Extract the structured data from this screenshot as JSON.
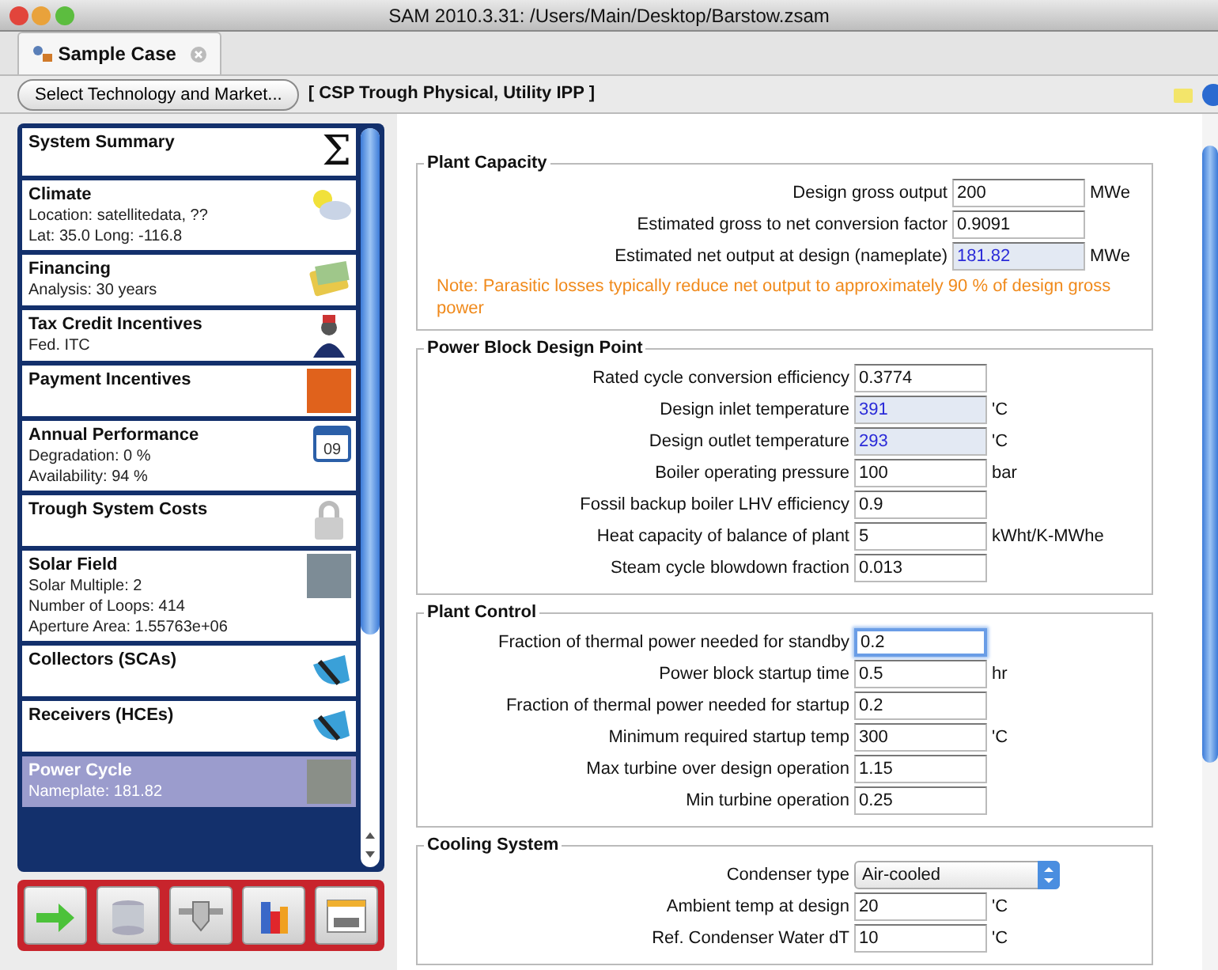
{
  "window": {
    "title": "SAM 2010.3.31: /Users/Main/Desktop/Barstow.zsam"
  },
  "tabs": [
    {
      "label": "Sample Case",
      "selected": true
    }
  ],
  "toolbar": {
    "button": "Select Technology and Market...",
    "technology": "[ CSP Trough Physical, Utility IPP ]"
  },
  "sidebar": {
    "items": [
      {
        "title": "System Summary",
        "symbol": "Σ",
        "selected": false
      },
      {
        "title": "Climate",
        "details": [
          "Location: satellitedata, ??",
          "Lat: 35.0 Long: -116.8"
        ],
        "selected": false
      },
      {
        "title": "Financing",
        "details": [
          "Analysis: 30 years"
        ],
        "selected": false
      },
      {
        "title": "Tax Credit Incentives",
        "details": [
          "Fed. ITC"
        ],
        "selected": false
      },
      {
        "title": "Payment Incentives",
        "selected": false
      },
      {
        "title": "Annual Performance",
        "details": [
          "Degradation: 0 %",
          "Availability: 94 %"
        ],
        "icon_text": "09",
        "selected": false
      },
      {
        "title": "Trough System Costs",
        "selected": false
      },
      {
        "title": "Solar Field",
        "details": [
          "Solar Multiple: 2",
          "Number of Loops: 414",
          "Aperture Area: 1.55763e+06"
        ],
        "selected": false
      },
      {
        "title": "Collectors (SCAs)",
        "selected": false
      },
      {
        "title": "Receivers (HCEs)",
        "selected": false
      },
      {
        "title": "Power Cycle",
        "details": [
          "Nameplate: 181.82"
        ],
        "selected": true
      }
    ]
  },
  "sections": [
    {
      "title": "Plant Capacity",
      "fields": [
        {
          "kind": "input",
          "label": "Design gross output",
          "value": "200",
          "unit": "MWe",
          "computed": false,
          "focused": false
        },
        {
          "kind": "input",
          "label": "Estimated gross to net conversion factor",
          "value": "0.9091",
          "computed": false,
          "focused": false
        },
        {
          "kind": "input",
          "label": "Estimated net output at design (nameplate)",
          "value": "181.82",
          "unit": "MWe",
          "computed": true,
          "focused": false
        }
      ],
      "note": "Note: Parasitic losses typically reduce net output to approximately 90 % of design gross power"
    },
    {
      "title": "Power Block Design Point",
      "fields": [
        {
          "kind": "input",
          "label": "Rated cycle conversion efficiency",
          "value": "0.3774",
          "computed": false,
          "focused": false
        },
        {
          "kind": "input",
          "label": "Design inlet temperature",
          "value": "391",
          "unit": "'C",
          "computed": true,
          "focused": false
        },
        {
          "kind": "input",
          "label": "Design outlet temperature",
          "value": "293",
          "unit": "'C",
          "computed": true,
          "focused": false
        },
        {
          "kind": "input",
          "label": "Boiler operating pressure",
          "value": "100",
          "unit": "bar",
          "computed": false,
          "focused": false
        },
        {
          "kind": "input",
          "label": "Fossil backup boiler LHV efficiency",
          "value": "0.9",
          "computed": false,
          "focused": false
        },
        {
          "kind": "input",
          "label": "Heat capacity of balance of plant",
          "value": "5",
          "unit": "kWht/K-MWhe",
          "computed": false,
          "focused": false
        },
        {
          "kind": "input",
          "label": "Steam cycle blowdown fraction",
          "value": "0.013",
          "computed": false,
          "focused": false
        }
      ]
    },
    {
      "title": "Plant Control",
      "fields": [
        {
          "kind": "input",
          "label": "Fraction of thermal power needed for standby",
          "value": "0.2",
          "computed": false,
          "focused": true
        },
        {
          "kind": "input",
          "label": "Power block startup time",
          "value": "0.5",
          "unit": "hr",
          "computed": false,
          "focused": false
        },
        {
          "kind": "input",
          "label": "Fraction of thermal power needed for startup",
          "value": "0.2",
          "computed": false,
          "focused": false
        },
        {
          "kind": "input",
          "label": "Minimum required startup temp",
          "value": "300",
          "unit": "'C",
          "computed": false,
          "focused": false
        },
        {
          "kind": "input",
          "label": "Max turbine over design operation",
          "value": "1.15",
          "computed": false,
          "focused": false
        },
        {
          "kind": "input",
          "label": "Min turbine operation",
          "value": "0.25",
          "computed": false,
          "focused": false
        }
      ]
    },
    {
      "title": "Cooling System",
      "fields": [
        {
          "kind": "select",
          "label": "Condenser type",
          "value": "Air-cooled"
        },
        {
          "kind": "input",
          "label": "Ambient temp at design",
          "value": "20",
          "unit": "'C",
          "computed": false,
          "focused": false
        },
        {
          "kind": "input",
          "label": "Ref. Condenser Water dT",
          "value": "10",
          "unit": "'C",
          "computed": false,
          "focused": false
        }
      ]
    }
  ]
}
